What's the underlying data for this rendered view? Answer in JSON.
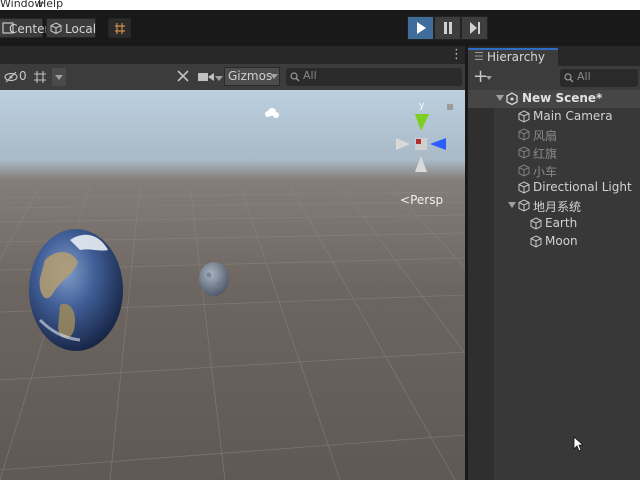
{
  "menu": {
    "window": "Window",
    "help": "Help"
  },
  "toolbar": {
    "pivot_label": "Center",
    "space_label": "Local",
    "play_active": true
  },
  "scene_toolbar": {
    "hidden_count": "0",
    "gizmos_label": "Gizmos",
    "search_placeholder": "All"
  },
  "viewport": {
    "projection_label": "Persp",
    "gizmo_axis_y": "y"
  },
  "hierarchy": {
    "tab_label": "Hierarchy",
    "search_placeholder": "All",
    "scene_name": "New Scene*",
    "items": [
      {
        "label": "Main Camera",
        "active": true
      },
      {
        "label": "风扇",
        "active": false
      },
      {
        "label": "红旗",
        "active": false
      },
      {
        "label": "小车",
        "active": false
      },
      {
        "label": "Directional Light",
        "active": true
      },
      {
        "label": "地月系统",
        "active": true
      },
      {
        "label": "Earth",
        "active": true
      },
      {
        "label": "Moon",
        "active": true
      }
    ]
  },
  "colors": {
    "play_active_bg": "#3f6e9d",
    "panel_dark": "#191919",
    "panel_mid": "#3c3c3c",
    "gizmo_y": "#7ccf21",
    "gizmo_z": "#2a5cff"
  }
}
